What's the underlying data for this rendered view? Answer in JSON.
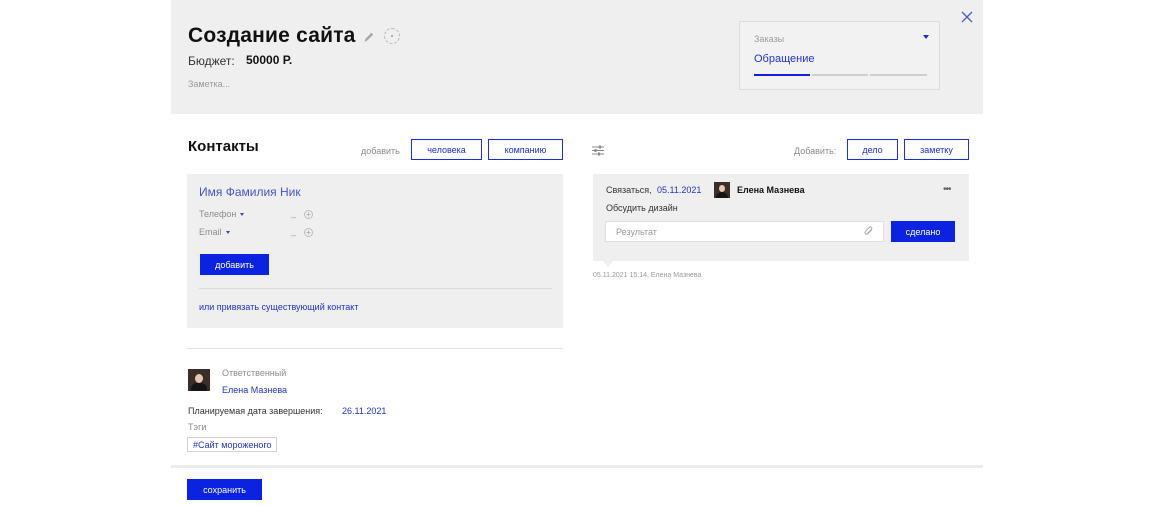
{
  "lead": {
    "title": "Создание сайта",
    "budget_label": "Бюджет:",
    "budget_value": "50000 Р.",
    "note_placeholder": "Заметка..."
  },
  "pipeline": {
    "name": "Заказы",
    "stage": "Обращение",
    "progress": 0.33
  },
  "contacts": {
    "title": "Контакты",
    "add_label": "добавить",
    "add_person": "человека",
    "add_company": "компанию",
    "card": {
      "name": "Имя Фамилия Ник",
      "phone_label": "Телефон",
      "phone_value": "_",
      "email_label": "Email",
      "email_value": "_",
      "add_button": "добавить",
      "link_existing": "или привязать существующий контакт"
    }
  },
  "responsible": {
    "label": "Ответственный",
    "name": "Елена Мазнева"
  },
  "due": {
    "label": "Планируемая дата завершения:",
    "value": "26.11.2021"
  },
  "tags": {
    "label": "Тэги",
    "items": [
      "#Сайт мороженого"
    ]
  },
  "feed": {
    "add_label": "Добавить:",
    "add_task": "дело",
    "add_note": "заметку",
    "task": {
      "type": "Связаться,",
      "date": "05.11.2021",
      "person": "Елена Мазнева",
      "text": "Обсудить дизайн",
      "result_placeholder": "Результат",
      "done_button": "сделано",
      "more": "•••"
    },
    "log": "05.11.2021 15:14, Елена Мазнева"
  },
  "footer": {
    "save_button": "сохранить"
  },
  "colors": {
    "accent": "#0b22e0",
    "link": "#2233cc",
    "panel": "#efefef"
  }
}
